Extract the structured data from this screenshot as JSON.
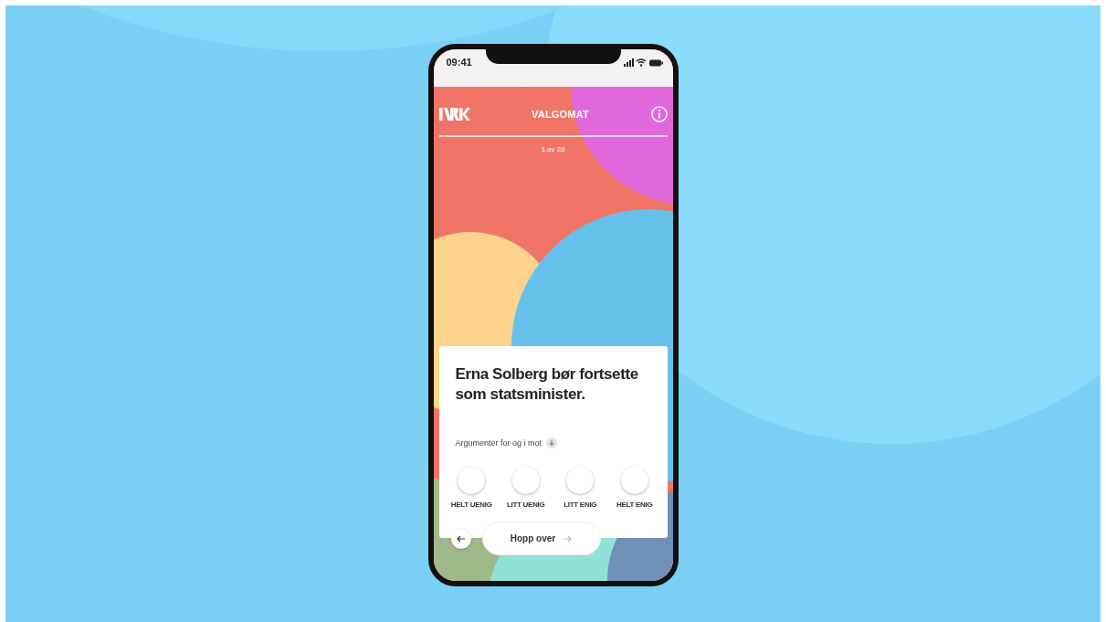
{
  "status_bar": {
    "time": "09:41"
  },
  "header": {
    "title": "VALGOMAT"
  },
  "progress": "**1** av 28",
  "question": {
    "text": "Erna Solberg bør fortsette som statsminister.",
    "arguments_label": "Argumenter for og i mot",
    "arguments_expanded": false
  },
  "options": [
    {
      "label": "HELT UENIG",
      "selected": false
    },
    {
      "label": "LITT UENIG",
      "selected": false
    },
    {
      "label": "LITT ENIG",
      "selected": false
    },
    {
      "label": "HELT ENIG",
      "selected": false
    }
  ],
  "skip_button": {
    "label": "Hopp over"
  }
}
